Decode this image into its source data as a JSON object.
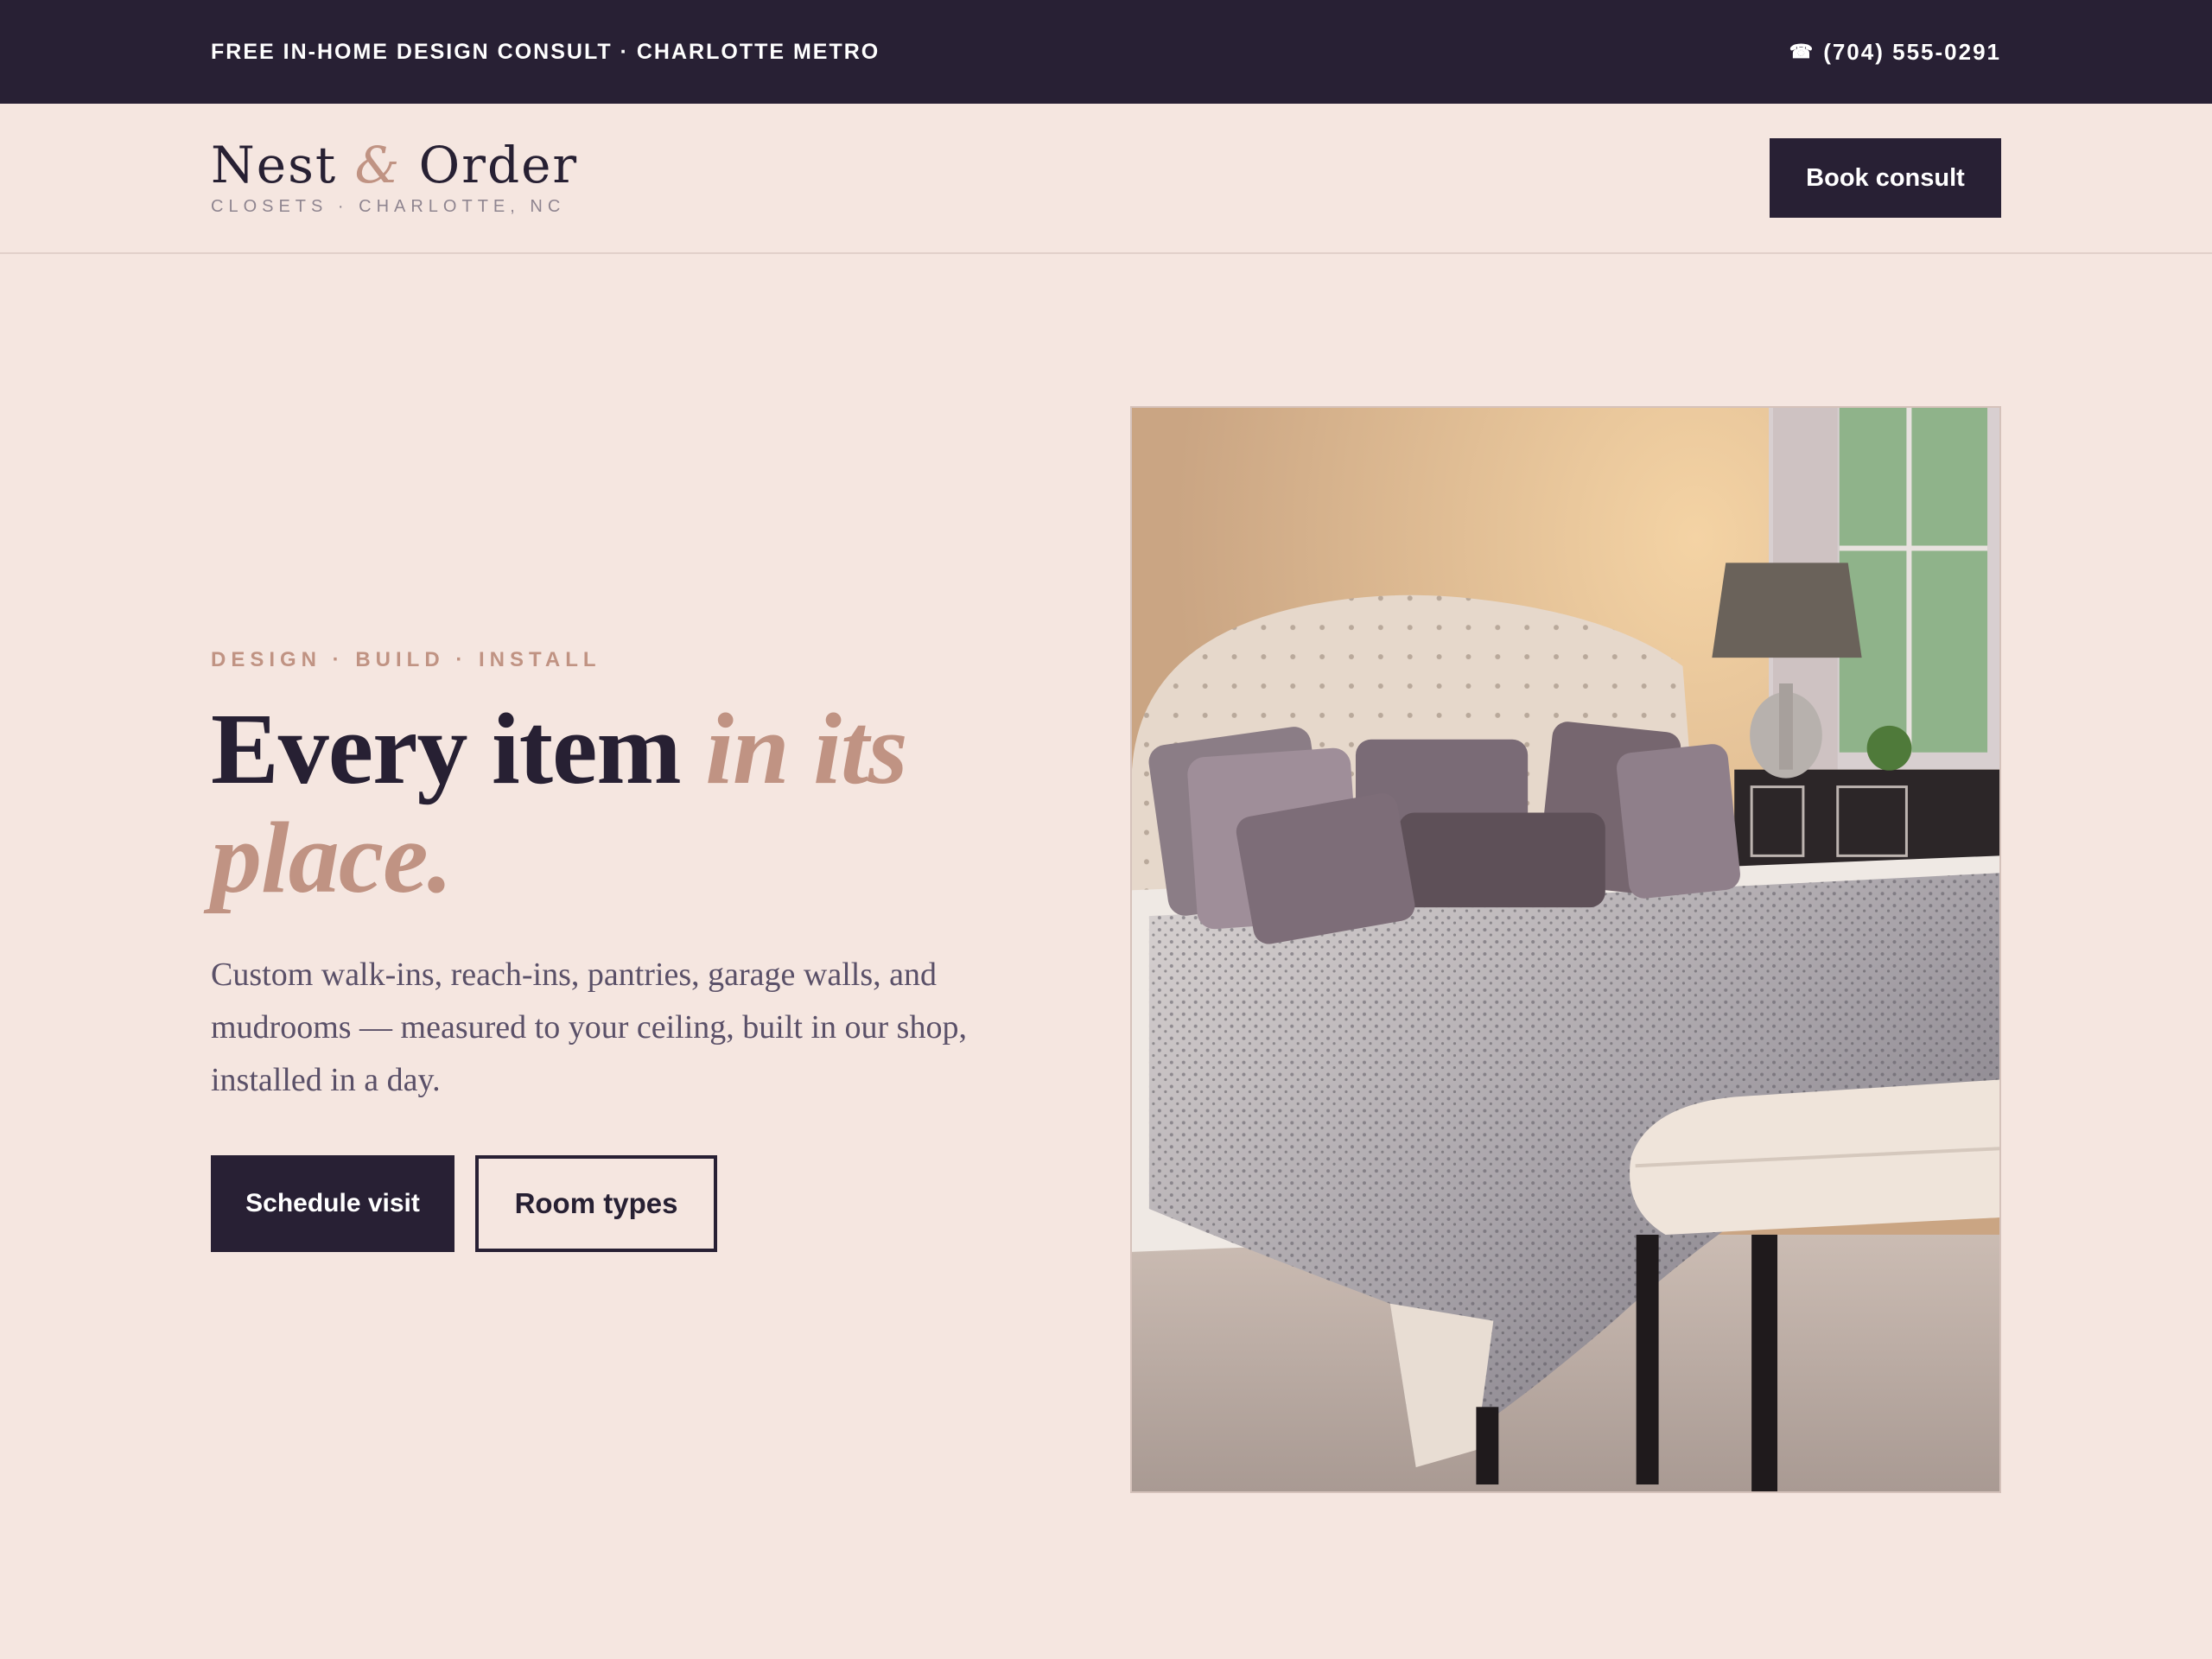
{
  "topbar": {
    "promo": "FREE IN-HOME DESIGN CONSULT · CHARLOTTE METRO",
    "phone_icon": "☎",
    "phone": "(704) 555-0291"
  },
  "header": {
    "logo_first": "Nest",
    "logo_amp": "&",
    "logo_second": "Order",
    "logo_sub": "CLOSETS · CHARLOTTE, NC",
    "cta_label": "Book consult"
  },
  "hero": {
    "eyebrow": "DESIGN · BUILD · INSTALL",
    "headline_plain": "Every item",
    "headline_accent": "in its place.",
    "lead": "Custom walk-ins, reach-ins, pantries, garage walls, and mudrooms — measured to your ceiling, built in our shop, installed in a day.",
    "primary_cta": "Schedule visit",
    "secondary_cta": "Room types"
  },
  "colors": {
    "ink": "#282034",
    "accent": "#c09383",
    "background": "#f5e6e0"
  }
}
